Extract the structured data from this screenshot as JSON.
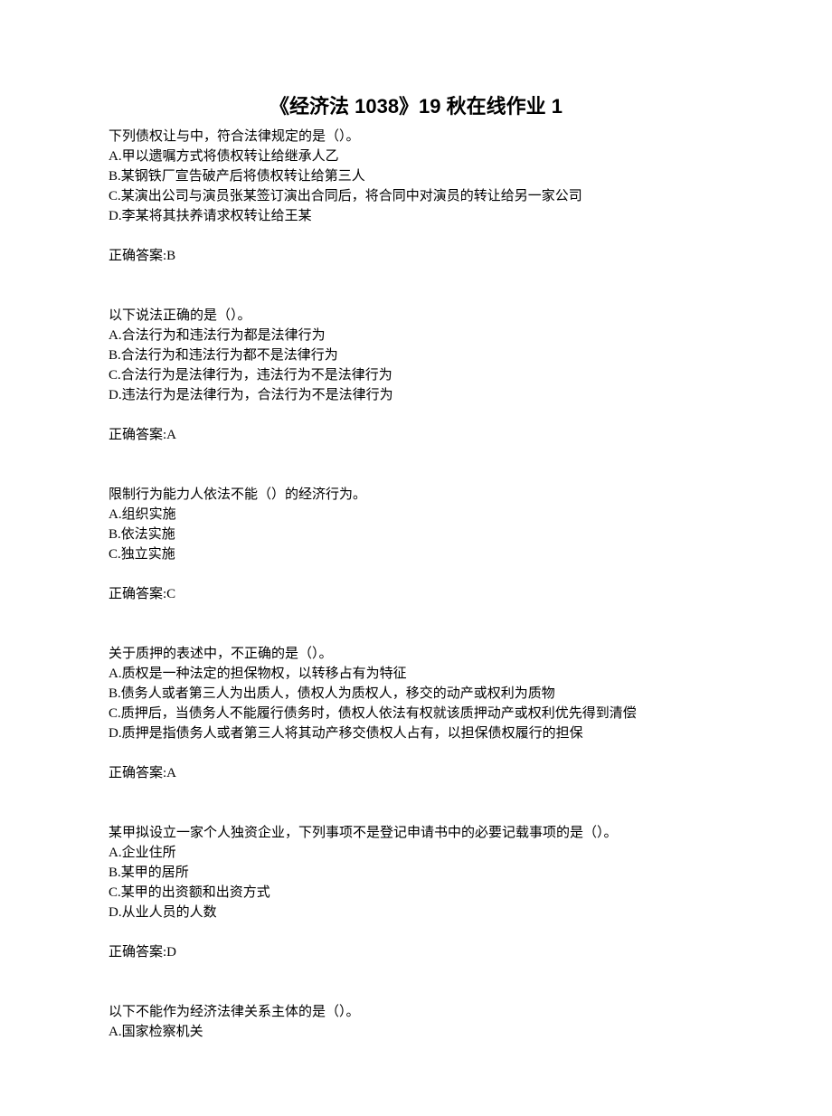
{
  "title": "《经济法 1038》19 秋在线作业 1",
  "questions": [
    {
      "stem": "下列债权让与中，符合法律规定的是（）。",
      "options": [
        "A.甲以遗嘱方式将债权转让给继承人乙",
        "B.某钢铁厂宣告破产后将债权转让给第三人",
        "C.某演出公司与演员张某签订演出合同后，将合同中对演员的转让给另一家公司",
        "D.李某将其扶养请求权转让给王某"
      ],
      "answer": "正确答案:B"
    },
    {
      "stem": "以下说法正确的是（）。",
      "options": [
        "A.合法行为和违法行为都是法律行为",
        "B.合法行为和违法行为都不是法律行为",
        "C.合法行为是法律行为，违法行为不是法律行为",
        "D.违法行为是法律行为，合法行为不是法律行为"
      ],
      "answer": "正确答案:A"
    },
    {
      "stem": "限制行为能力人依法不能（）的经济行为。",
      "options": [
        "A.组织实施",
        "B.依法实施",
        "C.独立实施"
      ],
      "answer": "正确答案:C"
    },
    {
      "stem": "关于质押的表述中，不正确的是（）。",
      "options": [
        "A.质权是一种法定的担保物权，以转移占有为特征",
        "B.债务人或者第三人为出质人，债权人为质权人，移交的动产或权利为质物",
        "C.质押后，当债务人不能履行债务时，债权人依法有权就该质押动产或权利优先得到清偿",
        "D.质押是指债务人或者第三人将其动产移交债权人占有，以担保债权履行的担保"
      ],
      "answer": "正确答案:A"
    },
    {
      "stem": "某甲拟设立一家个人独资企业，下列事项不是登记申请书中的必要记载事项的是（）。",
      "options": [
        "A.企业住所",
        "B.某甲的居所",
        "C.某甲的出资额和出资方式",
        "D.从业人员的人数"
      ],
      "answer": "正确答案:D"
    },
    {
      "stem": "以下不能作为经济法律关系主体的是（）。",
      "options": [
        "A.国家检察机关"
      ],
      "answer": ""
    }
  ]
}
